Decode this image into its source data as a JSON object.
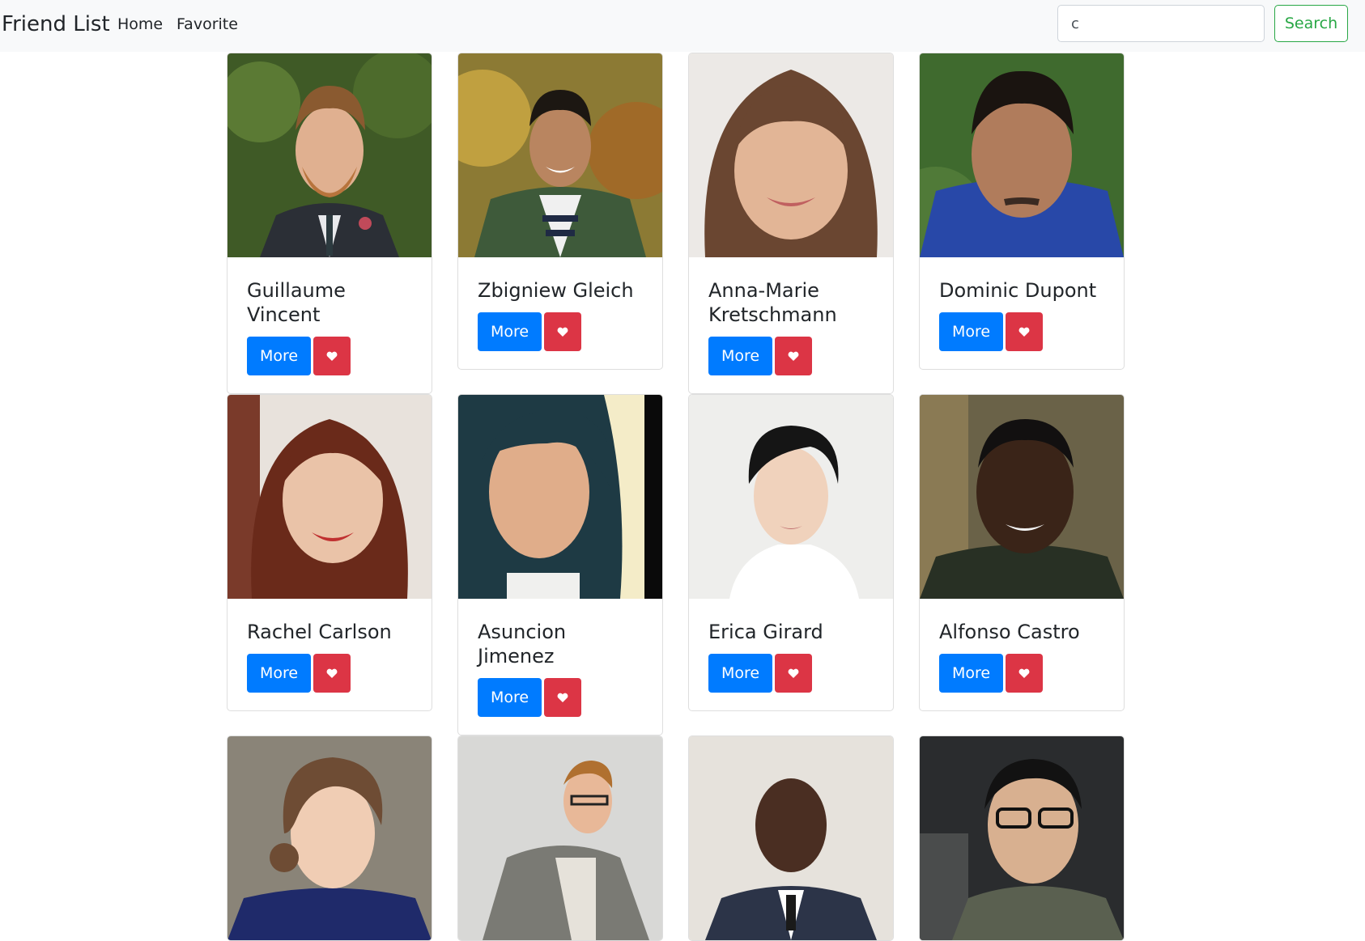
{
  "navbar": {
    "brand": "Friend List",
    "links": [
      "Home",
      "Favorite"
    ]
  },
  "search": {
    "value": "c",
    "button_label": "Search"
  },
  "colors": {
    "navbar_bg": "#f8f9fa",
    "more_button": "#007bff",
    "favorite_button": "#dc3545",
    "search_button": "#28a745"
  },
  "cards": [
    {
      "name": "Guillaume Vincent",
      "more": "More",
      "fav_icon": "heart-icon",
      "photo": "man with red beard in suit"
    },
    {
      "name": "Zbigniew Gleich",
      "more": "More",
      "fav_icon": "heart-icon",
      "photo": "smiling man in green jacket"
    },
    {
      "name": "Anna-Marie Kretschmann",
      "more": "More",
      "fav_icon": "heart-icon",
      "photo": "smiling woman with bangs"
    },
    {
      "name": "Dominic Dupont",
      "more": "More",
      "fav_icon": "heart-icon",
      "photo": "man in blue shirt lying on grass"
    },
    {
      "name": "Rachel Carlson",
      "more": "More",
      "fav_icon": "heart-icon",
      "photo": "smiling woman with auburn hair"
    },
    {
      "name": "Asuncion Jimenez",
      "more": "More",
      "fav_icon": "heart-icon",
      "photo": "woman with dark hair selfie"
    },
    {
      "name": "Erica Girard",
      "more": "More",
      "fav_icon": "heart-icon",
      "photo": "woman with short black hair"
    },
    {
      "name": "Alfonso Castro",
      "more": "More",
      "fav_icon": "heart-icon",
      "photo": "smiling man in green shirt"
    },
    {
      "photo": "young woman with braided hair"
    },
    {
      "photo": "man with glasses and plaid shirt"
    },
    {
      "photo": "bald man in suit and tie"
    },
    {
      "photo": "smiling man with glasses"
    }
  ]
}
